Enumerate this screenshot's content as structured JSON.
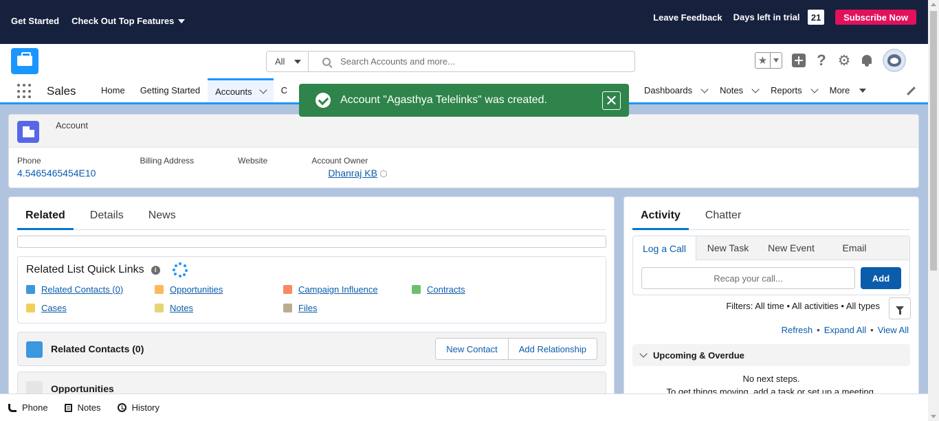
{
  "trial_bar": {
    "get_started": "Get Started",
    "top_features": "Check Out Top Features",
    "leave_feedback": "Leave Feedback",
    "days_left_label": "Days left in trial",
    "days_left_value": "21",
    "subscribe": "Subscribe Now"
  },
  "header": {
    "search_scope": "All",
    "search_placeholder": "Search Accounts and more..."
  },
  "nav": {
    "app_name": "Sales",
    "items": [
      "Home",
      "Getting Started",
      "Accounts",
      "C"
    ],
    "right_items": [
      "Dashboards",
      "Notes",
      "Reports",
      "More"
    ]
  },
  "toast": {
    "message": "Account \"Agasthya Telelinks\" was created."
  },
  "record": {
    "object_label": "Account",
    "fields": [
      {
        "label": "Phone",
        "value": "4.5465465454E10"
      },
      {
        "label": "Billing Address",
        "value": ""
      },
      {
        "label": "Website",
        "value": ""
      },
      {
        "label": "Account Owner",
        "value": "Dhanraj KB"
      }
    ]
  },
  "left": {
    "tabs": [
      "Related",
      "Details",
      "News"
    ],
    "quick_links_title": "Related List Quick Links",
    "quick_links": [
      {
        "label": "Related Contacts (0)",
        "color": "#3c97dd"
      },
      {
        "label": "Opportunities",
        "color": "#fcb95b"
      },
      {
        "label": "Campaign Influence",
        "color": "#f88962"
      },
      {
        "label": "Contracts",
        "color": "#6ec06e"
      },
      {
        "label": "Cases",
        "color": "#f2cf5b"
      },
      {
        "label": "Notes",
        "color": "#e6d478"
      },
      {
        "label": "Files",
        "color": "#baac93"
      }
    ],
    "related_contacts_title": "Related Contacts (0)",
    "new_contact": "New Contact",
    "add_relationship": "Add Relationship",
    "opportunities_title": "Opportunities"
  },
  "right": {
    "tabs": [
      "Activity",
      "Chatter"
    ],
    "composer_tabs": [
      "Log a Call",
      "New Task",
      "New Event",
      "Email"
    ],
    "recap_placeholder": "Recap your call...",
    "add": "Add",
    "filters": "Filters: All time • All activities • All types",
    "refresh": "Refresh",
    "expand_all": "Expand All",
    "view_all": "View All",
    "upcoming": "Upcoming & Overdue",
    "no_steps": "No next steps.",
    "get_moving": "To get things moving, add a task or set up a meeting."
  },
  "utility_bar": {
    "phone": "Phone",
    "notes": "Notes",
    "history": "History"
  },
  "colors": {
    "trial_bar": "#16213e",
    "brand_blue": "#1b96ff",
    "toast_green": "#2e844a",
    "subscribe_pink": "#e3115c",
    "link_blue": "#0b5cab"
  }
}
